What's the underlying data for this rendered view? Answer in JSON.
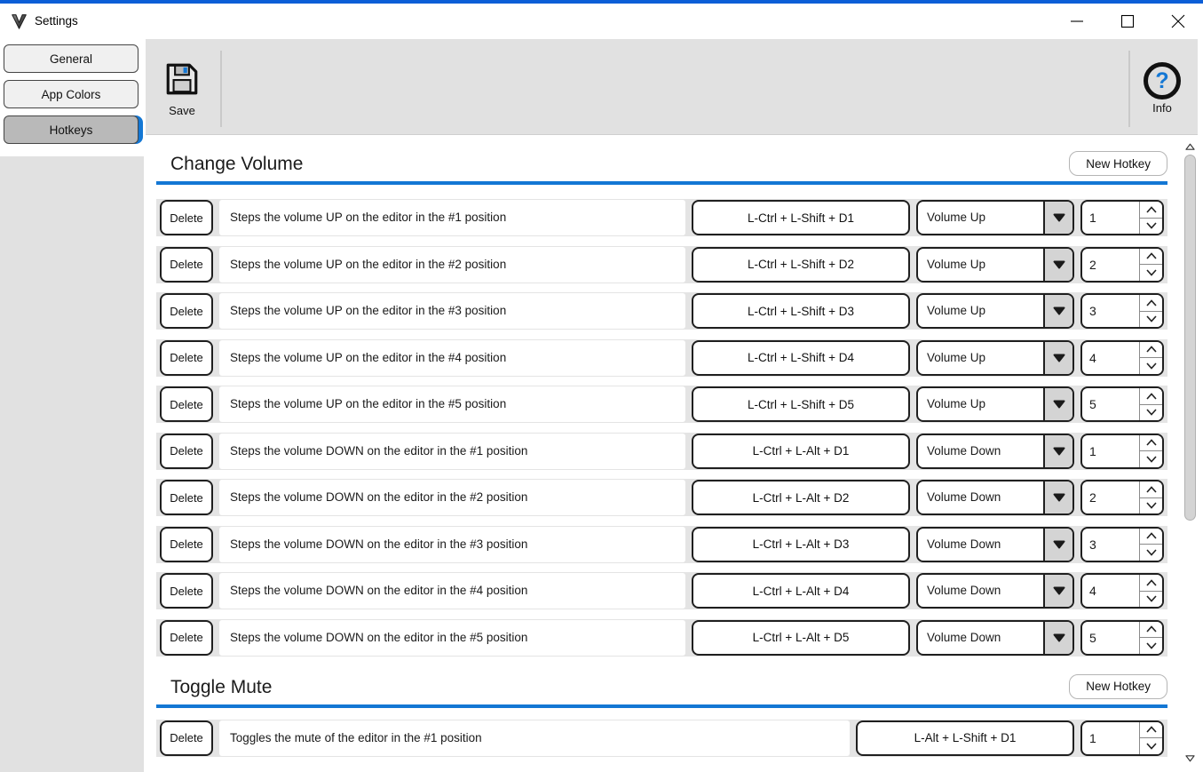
{
  "window": {
    "title": "Settings"
  },
  "icons": {
    "app_logo": "v-shield",
    "minimize": "—",
    "maximize": "□",
    "close": "✕",
    "save": "floppy-disk",
    "info": "question-mark-circle",
    "dropdown_arrow": "▼",
    "spinner_up": "∧",
    "spinner_down": "∨",
    "scroll_up": "△",
    "scroll_down": "▽"
  },
  "colors": {
    "accent": "#1377d4",
    "strip": "#0b5ed7",
    "toolbar_gray": "#e1e1e1",
    "row_gray": "#e4e4e4",
    "selected_tab_gray": "#b9b9b9"
  },
  "sidebar": {
    "items": [
      {
        "label": "General",
        "selected": false
      },
      {
        "label": "App Colors",
        "selected": false
      },
      {
        "label": "Hotkeys",
        "selected": true
      }
    ]
  },
  "toolbar": {
    "save_label": "Save",
    "info_label": "Info"
  },
  "sections": [
    {
      "title": "Change Volume",
      "new_hotkey_label": "New Hotkey",
      "rows": [
        {
          "delete_label": "Delete",
          "description": "Steps the volume UP on the editor in the #1 position",
          "hotkey": "L-Ctrl + L-Shift + D1",
          "action": "Volume Up",
          "position": "1"
        },
        {
          "delete_label": "Delete",
          "description": "Steps the volume UP on the editor in the #2 position",
          "hotkey": "L-Ctrl + L-Shift + D2",
          "action": "Volume Up",
          "position": "2"
        },
        {
          "delete_label": "Delete",
          "description": "Steps the volume UP on the editor in the #3 position",
          "hotkey": "L-Ctrl + L-Shift + D3",
          "action": "Volume Up",
          "position": "3"
        },
        {
          "delete_label": "Delete",
          "description": "Steps the volume UP on the editor in the #4 position",
          "hotkey": "L-Ctrl + L-Shift + D4",
          "action": "Volume Up",
          "position": "4"
        },
        {
          "delete_label": "Delete",
          "description": "Steps the volume UP on the editor in the #5 position",
          "hotkey": "L-Ctrl + L-Shift + D5",
          "action": "Volume Up",
          "position": "5"
        },
        {
          "delete_label": "Delete",
          "description": "Steps the volume DOWN on the editor in the #1 position",
          "hotkey": "L-Ctrl + L-Alt + D1",
          "action": "Volume Down",
          "position": "1"
        },
        {
          "delete_label": "Delete",
          "description": "Steps the volume DOWN on the editor in the #2 position",
          "hotkey": "L-Ctrl + L-Alt + D2",
          "action": "Volume Down",
          "position": "2"
        },
        {
          "delete_label": "Delete",
          "description": "Steps the volume DOWN on the editor in the #3 position",
          "hotkey": "L-Ctrl + L-Alt + D3",
          "action": "Volume Down",
          "position": "3"
        },
        {
          "delete_label": "Delete",
          "description": "Steps the volume DOWN on the editor in the #4 position",
          "hotkey": "L-Ctrl + L-Alt + D4",
          "action": "Volume Down",
          "position": "4"
        },
        {
          "delete_label": "Delete",
          "description": "Steps the volume DOWN on the editor in the #5 position",
          "hotkey": "L-Ctrl + L-Alt + D5",
          "action": "Volume Down",
          "position": "5"
        }
      ]
    },
    {
      "title": "Toggle Mute",
      "new_hotkey_label": "New Hotkey",
      "rows": [
        {
          "delete_label": "Delete",
          "description": "Toggles the mute of the editor in the #1 position",
          "hotkey": "L-Alt + L-Shift + D1",
          "action": null,
          "position": "1"
        }
      ]
    }
  ]
}
